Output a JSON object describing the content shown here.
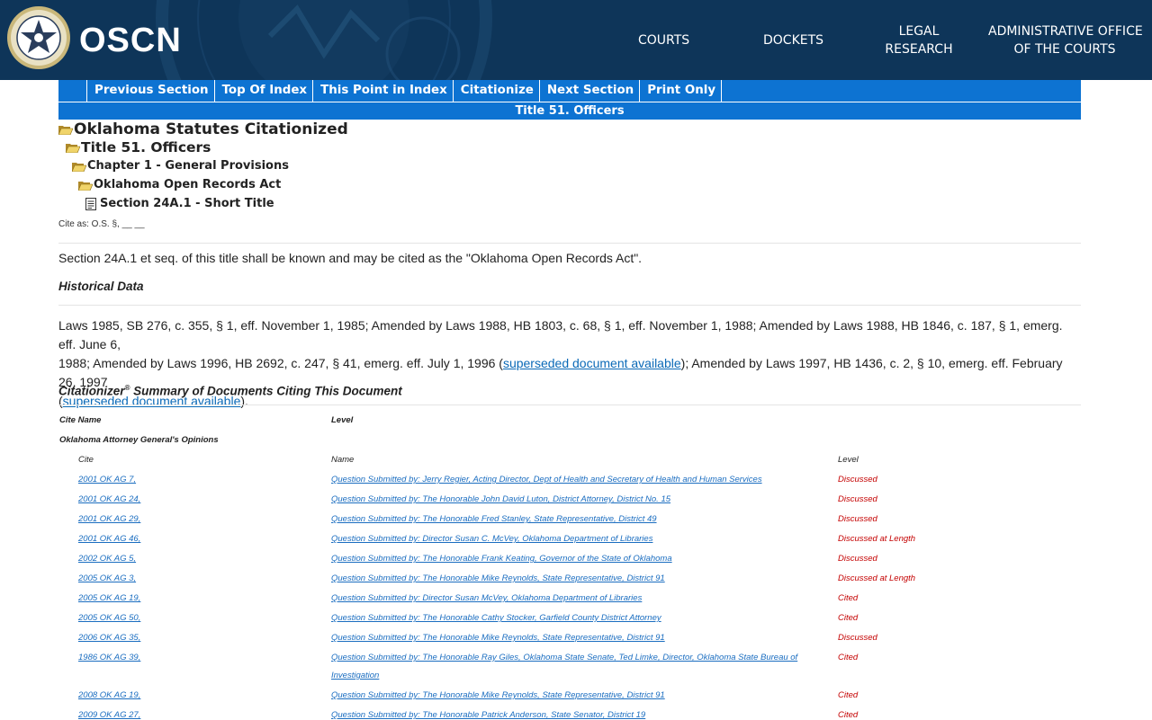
{
  "header": {
    "brand": "OSCN",
    "nav": {
      "courts": "COURTS",
      "dockets": "DOCKETS",
      "legal_research_1": "LEGAL",
      "legal_research_2": "RESEARCH",
      "aoc_1": "ADMINISTRATIVE OFFICE",
      "aoc_2": "OF THE COURTS"
    }
  },
  "toolbar": {
    "items": [
      "Previous Section",
      "Top Of Index",
      "This Point in Index",
      "Citationize",
      "Next Section",
      "Print Only"
    ],
    "title": "Title 51. Officers"
  },
  "tree": {
    "level1": "Oklahoma Statutes Citationized",
    "level2": "Title 51. Officers",
    "level3": "Chapter 1 - General Provisions",
    "level4": "Oklahoma Open Records Act",
    "level5": "Section 24A.1 - Short Title"
  },
  "cite_as": "Cite as: O.S. §, __ __",
  "body_text": "Section 24A.1 et seq. of this title shall be known and may be cited as the \"Oklahoma Open Records Act\".",
  "historical": {
    "heading": "Historical Data",
    "line1": "Laws 1985, SB 276, c. 355, § 1, eff. November 1, 1985; Amended by Laws 1988, HB 1803, c. 68, § 1, eff. November 1, 1988; Amended by Laws 1988, HB 1846, c. 187, § 1, emerg. eff. June 6,",
    "line2_a": "1988; Amended by Laws 1996, HB 2692, c. 247, § 41, emerg. eff. July 1, 1996 (",
    "link1": "superseded document available",
    "line2_b": "); Amended by Laws 1997, HB 1436, c. 2, § 10, emerg. eff. February 26, 1997",
    "line3_a": "(",
    "link2": "superseded document available",
    "line3_b": ")."
  },
  "citationizer": {
    "heading": "Citationizer",
    "reg": "®",
    "heading_rest": " Summary of Documents Citing This Document",
    "col_cite_name": "Cite Name",
    "col_level": "Level",
    "group": "Oklahoma Attorney General's Opinions",
    "sub_cite": "Cite",
    "sub_name": "Name",
    "sub_level": "Level",
    "rows": [
      {
        "cite": "2001 OK AG 7,",
        "name": "Question Submitted by: Jerry Regier, Acting Director, Dept of Health and Secretary of Health and Human Services",
        "name2": "",
        "level": "Discussed"
      },
      {
        "cite": "2001 OK AG 24,",
        "name": "Question Submitted by: The Honorable John David Luton, District Attorney, District No. 15",
        "name2": "",
        "level": "Discussed"
      },
      {
        "cite": "2001 OK AG 29,",
        "name": "Question Submitted by: The Honorable Fred Stanley, State Representative, District 49",
        "name2": "",
        "level": "Discussed"
      },
      {
        "cite": "2001 OK AG 46,",
        "name": "Question Submitted by: Director Susan C. McVey, Oklahoma Department of Libraries",
        "name2": "",
        "level": "Discussed at Length"
      },
      {
        "cite": "2002 OK AG 5,",
        "name": "Question Submitted by: The Honorable Frank Keating, Governor of the State of Oklahoma",
        "name2": "",
        "level": "Discussed"
      },
      {
        "cite": "2005 OK AG 3,",
        "name": "Question Submitted by: The Honorable Mike Reynolds, State Representative, District 91",
        "name2": "",
        "level": "Discussed at Length"
      },
      {
        "cite": "2005 OK AG 19,",
        "name": "Question Submitted by: Director Susan McVey, Oklahoma Department of Libraries",
        "name2": "",
        "level": "Cited"
      },
      {
        "cite": "2005 OK AG 50,",
        "name": "Question Submitted by: The Honorable Cathy Stocker, Garfield County District Attorney",
        "name2": "",
        "level": "Cited"
      },
      {
        "cite": "2006 OK AG 35,",
        "name": "Question Submitted by: The Honorable Mike Reynolds, State Representative, District 91",
        "name2": "",
        "level": "Discussed"
      },
      {
        "cite": "1986 OK AG 39,",
        "name": "Question Submitted by: The Honorable Ray Giles, Oklahoma State Senate, Ted Limke, Director, Oklahoma State Bureau of",
        "name2": "Investigation",
        "level": "Cited"
      },
      {
        "cite": "2008 OK AG 19,",
        "name": "Question Submitted by: The Honorable Mike Reynolds, State Representative, District 91",
        "name2": "",
        "level": "Cited"
      },
      {
        "cite": "2009 OK AG 27,",
        "name": "Question Submitted by: The Honorable Patrick Anderson, State Senator, District 19",
        "name2": "",
        "level": "Cited"
      }
    ]
  },
  "colors": {
    "header_bg": "#0e3559",
    "toolbar_bg": "#0d73d2",
    "link": "#0a69b7",
    "level_red": "#c40000"
  }
}
